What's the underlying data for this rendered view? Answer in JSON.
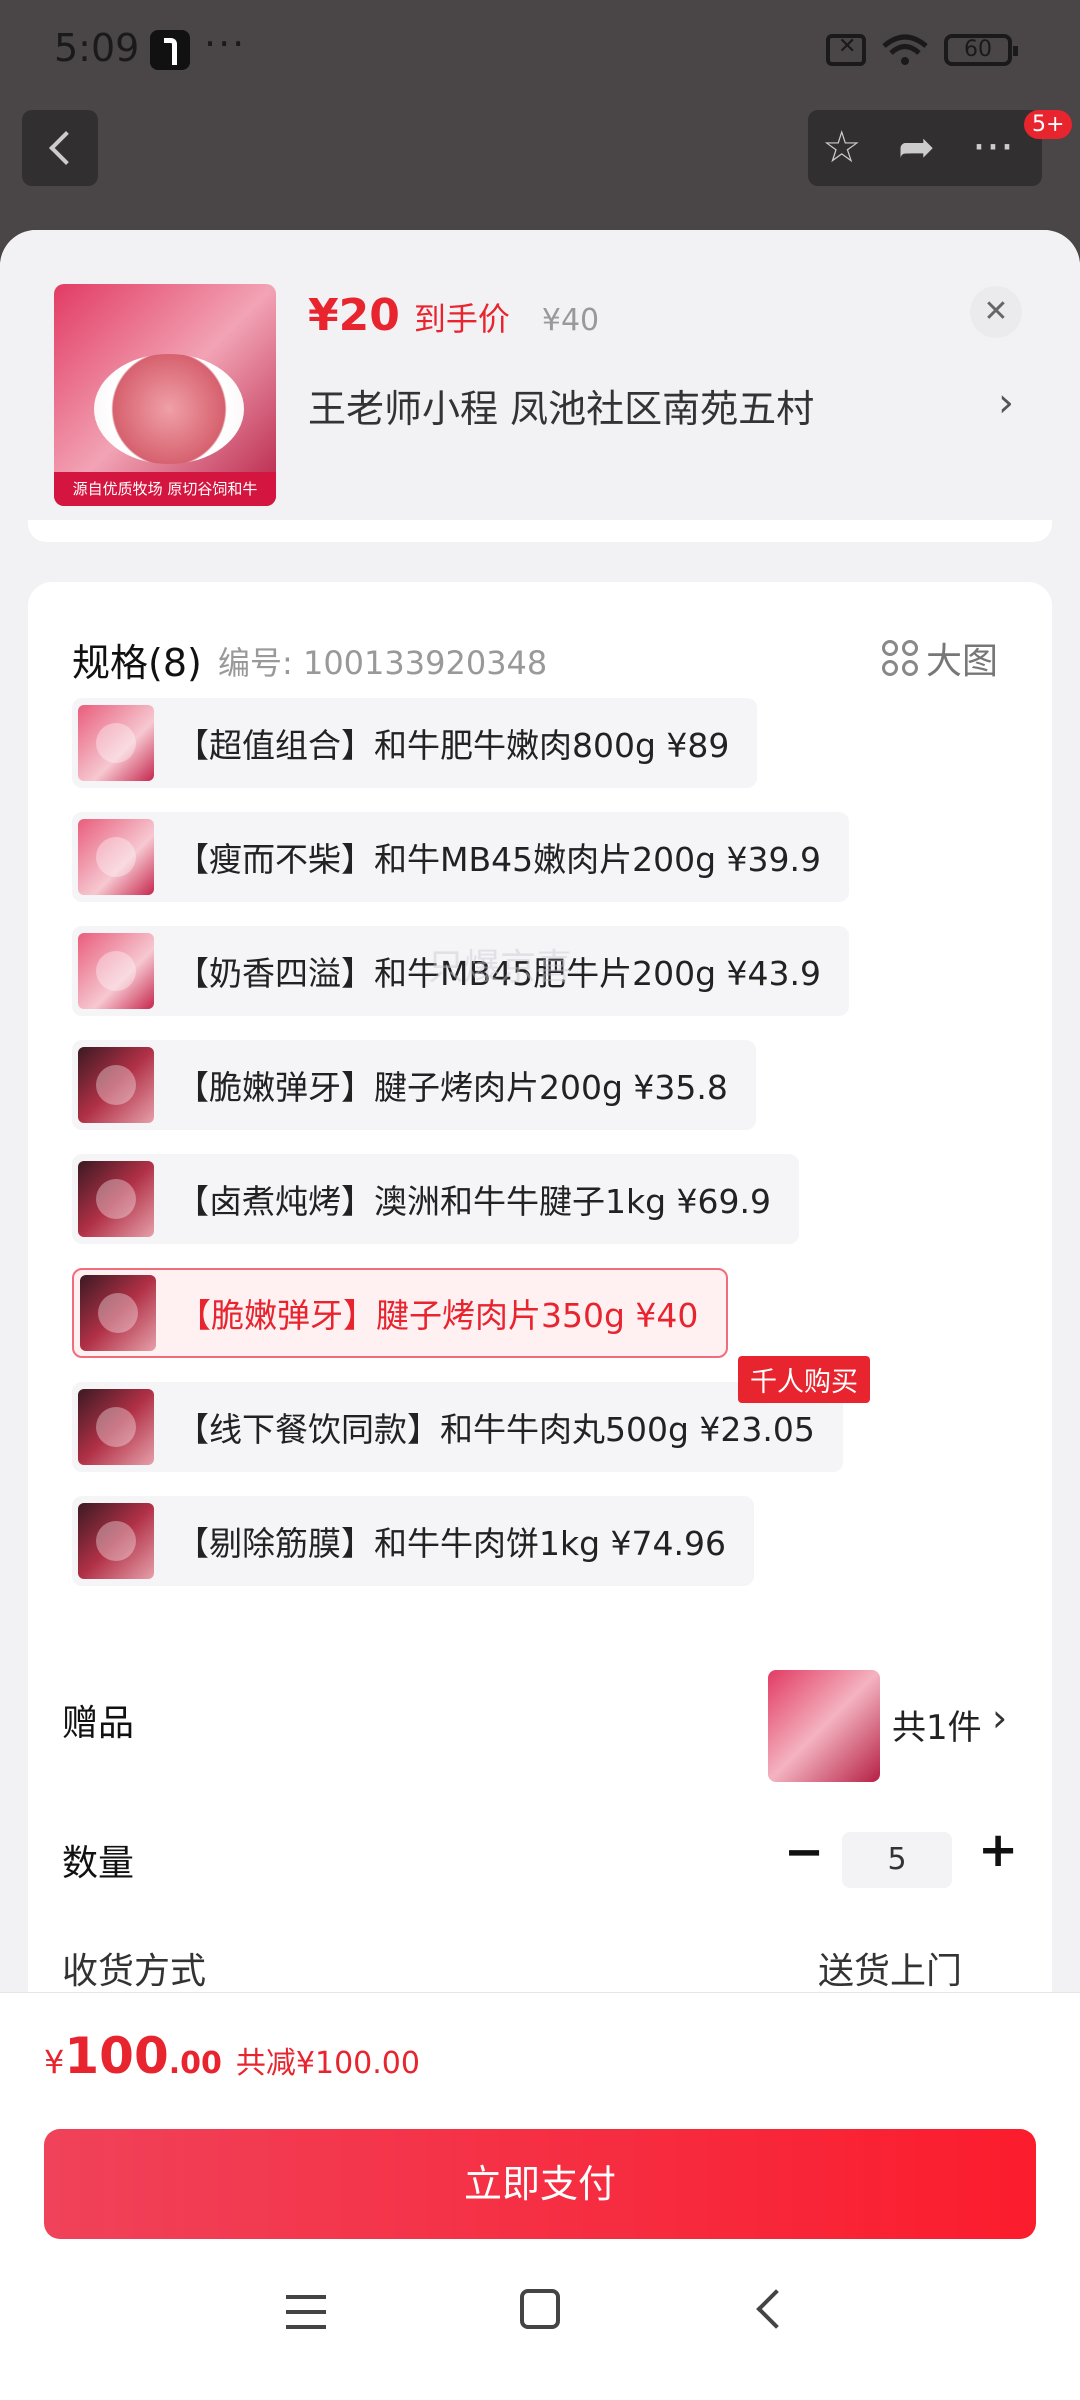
{
  "status": {
    "time": "5:09",
    "battery": "60"
  },
  "header": {
    "badge": "5+"
  },
  "sku": {
    "price": "¥20",
    "price_label": "到手价",
    "old_price": "¥40",
    "seller": "王老师小程  凤池社区南苑五村",
    "thumb_caption": "源自优质牧场  原切谷饲和牛"
  },
  "spec": {
    "heading": "规格(8)",
    "code": "编号: 100133920348",
    "big_image_label": "大图",
    "options": [
      {
        "label": "【超值组合】和牛肥牛嫩肉800g  ¥89"
      },
      {
        "label": "【瘦而不柴】和牛MB45嫩肉片200g  ¥39.9"
      },
      {
        "label": "【奶香四溢】和牛MB45肥牛片200g  ¥43.9"
      },
      {
        "label": "【脆嫩弹牙】腱子烤肉片200g  ¥35.8"
      },
      {
        "label": "【卤煮炖烤】澳洲和牛牛腱子1kg  ¥69.9"
      },
      {
        "label": "【脆嫩弹牙】腱子烤肉片350g  ¥40"
      },
      {
        "label": "【线下餐饮同款】和牛牛肉丸500g  ¥23.05"
      },
      {
        "label": "【剔除筋膜】和牛牛肉饼1kg  ¥74.96"
      }
    ],
    "hot_badge": "千人购买",
    "watermark": "只爆京喜"
  },
  "gift": {
    "label": "赠品",
    "count": "共1件"
  },
  "quantity": {
    "label": "数量",
    "value": "5"
  },
  "delivery": {
    "label": "收货方式",
    "value": "送货上门"
  },
  "footer": {
    "currency": "¥",
    "amount": "100",
    "decimals": ".00",
    "discount": "共减¥100.00",
    "pay_label": "立即支付"
  }
}
